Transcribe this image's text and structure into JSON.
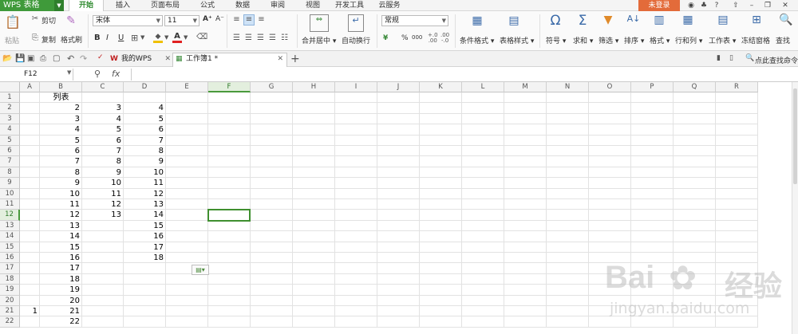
{
  "app": {
    "logo": "WPS 表格",
    "login": "未登录"
  },
  "menu": {
    "tabs": [
      "开始",
      "插入",
      "页面布局",
      "公式",
      "数据",
      "审阅",
      "视图",
      "开发工具",
      "云服务"
    ],
    "active": 0
  },
  "ribbon": {
    "paste": "粘贴",
    "cut": "剪切",
    "copy": "复制",
    "format_painter": "格式刷",
    "font_name": "宋体",
    "font_size": "11",
    "bold": "B",
    "italic": "I",
    "underline": "U",
    "font_grow": "A⁺",
    "font_shrink": "A⁻",
    "merge_center": "合并居中",
    "wrap_text": "自动换行",
    "number_format": "常规",
    "currency": "¥",
    "percent": "%",
    "comma": "000",
    "cond_format": "条件格式",
    "table_style": "表格样式",
    "symbol": "符号",
    "sum": "求和",
    "filter": "筛选",
    "sort": "排序",
    "format": "格式",
    "rows_cols": "行和列",
    "worksheet": "工作表",
    "freeze": "冻结窗格",
    "find": "查找"
  },
  "doc_tabs": {
    "mywps": "我的WPS",
    "workbook": "工作簿1 *",
    "new_tab": "+",
    "find_cmd": "点此查找命令"
  },
  "formula_bar": {
    "name_box": "F12",
    "fx": "fx",
    "value": ""
  },
  "sheet": {
    "columns": [
      "A",
      "B",
      "C",
      "D",
      "E",
      "F",
      "G",
      "H",
      "I",
      "J",
      "K",
      "L",
      "M",
      "N",
      "O",
      "P",
      "Q",
      "R"
    ],
    "active_col": "F",
    "rows": [
      "1",
      "2",
      "3",
      "4",
      "5",
      "6",
      "7",
      "8",
      "9",
      "10",
      "11",
      "12",
      "13",
      "14",
      "15",
      "16",
      "17",
      "18",
      "19",
      "20",
      "21",
      "22"
    ],
    "active_row": "12",
    "header_text": "列表",
    "col_b": [
      "2",
      "3",
      "4",
      "5",
      "6",
      "7",
      "8",
      "9",
      "10",
      "11",
      "12",
      "13",
      "14",
      "15",
      "16",
      "17",
      "18",
      "19",
      "20",
      "21",
      "22"
    ],
    "col_c": [
      "3",
      "4",
      "5",
      "6",
      "7",
      "8",
      "9",
      "10",
      "11",
      "12",
      "13"
    ],
    "col_d": [
      "4",
      "5",
      "6",
      "7",
      "8",
      "9",
      "10",
      "11",
      "12",
      "13",
      "14",
      "15",
      "16",
      "17",
      "18"
    ],
    "a21": "1"
  },
  "watermark": {
    "brand": "Bai",
    "brand_cn": "经验",
    "url": "jingyan.baidu.com"
  }
}
